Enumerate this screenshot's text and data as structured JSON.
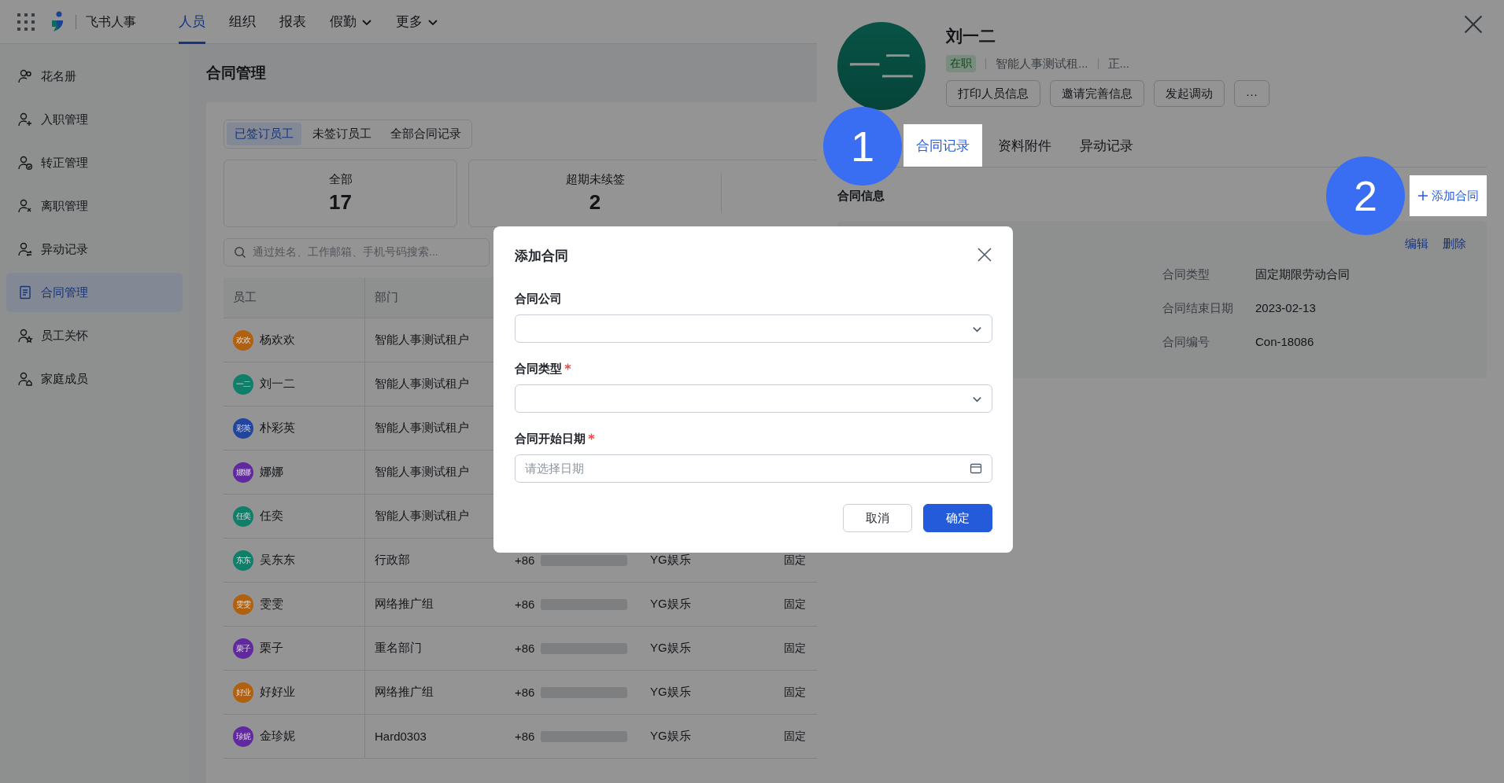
{
  "top_nav": {
    "app_name": "飞书人事",
    "tabs": [
      {
        "label": "人员",
        "selected": true,
        "has_caret": false
      },
      {
        "label": "组织",
        "selected": false,
        "has_caret": false
      },
      {
        "label": "报表",
        "selected": false,
        "has_caret": false
      },
      {
        "label": "假勤",
        "selected": false,
        "has_caret": true
      },
      {
        "label": "更多",
        "selected": false,
        "has_caret": true
      }
    ]
  },
  "sidebar": {
    "items": [
      {
        "label": "花名册",
        "selected": false
      },
      {
        "label": "入职管理",
        "selected": false
      },
      {
        "label": "转正管理",
        "selected": false
      },
      {
        "label": "离职管理",
        "selected": false
      },
      {
        "label": "异动记录",
        "selected": false
      },
      {
        "label": "合同管理",
        "selected": true
      },
      {
        "label": "员工关怀",
        "selected": false
      },
      {
        "label": "家庭成员",
        "selected": false
      }
    ]
  },
  "page": {
    "title": "合同管理",
    "filter_tabs": [
      {
        "label": "已签订员工",
        "selected": true
      },
      {
        "label": "未签订员工",
        "selected": false
      },
      {
        "label": "全部合同记录",
        "selected": false
      }
    ],
    "stats": [
      {
        "label": "全部",
        "value": "17"
      },
      {
        "label": "超期未续签",
        "value": "2"
      }
    ],
    "search": {
      "placeholder": "通过姓名、工作邮箱、手机号码搜索..."
    },
    "table": {
      "columns": [
        "员工",
        "部门"
      ],
      "rows": [
        {
          "avatar_text": "欢欢",
          "color": "#b0600e",
          "name": "杨欢欢",
          "department": "智能人事测试租户"
        },
        {
          "avatar_text": "一二",
          "color": "#0f7f6a",
          "name": "刘一二",
          "department": "智能人事测试租户"
        },
        {
          "avatar_text": "彩英",
          "color": "#21459f",
          "name": "朴彩英",
          "department": "智能人事测试租户"
        },
        {
          "avatar_text": "娜娜",
          "color": "#62289f",
          "name": "娜娜",
          "department": "智能人事测试租户"
        },
        {
          "avatar_text": "任奕",
          "color": "#0f7f6a",
          "name": "任奕",
          "department": "智能人事测试租户"
        },
        {
          "avatar_text": "东东",
          "color": "#0f7f6a",
          "name": "吴东东",
          "department": "行政部",
          "phone_prefix": "+86",
          "company": "YG娱乐",
          "column_5": "固定"
        },
        {
          "avatar_text": "雯雯",
          "color": "#b0600e",
          "name": "雯雯",
          "department": "网络推广组",
          "phone_prefix": "+86",
          "company": "YG娱乐",
          "column_5": "固定"
        },
        {
          "avatar_text": "栗子",
          "color": "#62289f",
          "name": "栗子",
          "department": "重名部门",
          "phone_prefix": "+86",
          "company": "YG娱乐",
          "column_5": "固定"
        },
        {
          "avatar_text": "好业",
          "color": "#b0600e",
          "name": "好好业",
          "department": "网络推广组",
          "phone_prefix": "+86",
          "company": "YG娱乐",
          "column_5": "固定"
        },
        {
          "avatar_text": "珍妮",
          "color": "#62289f",
          "name": "金珍妮",
          "department": "Hard0303",
          "phone_prefix": "+86",
          "company": "YG娱乐",
          "column_5": "固定"
        }
      ]
    }
  },
  "drawer": {
    "name": "刘一二",
    "avatar_text": "一二",
    "status": "在职",
    "meta": [
      "智能人事测试租...",
      "正..."
    ],
    "actions": [
      "打印人员信息",
      "邀请完善信息",
      "发起调动",
      "···"
    ],
    "tabs": [
      {
        "label": "合同记录",
        "selected": true,
        "highlighted": true,
        "callout": "1"
      },
      {
        "label": "资料附件",
        "selected": false,
        "highlighted": false
      },
      {
        "label": "异动记录",
        "selected": false,
        "highlighted": false
      }
    ],
    "section_title": "合同信息",
    "add_button": {
      "label": "添加合同",
      "highlighted": true,
      "callout": "2"
    },
    "record": {
      "actions": [
        "编辑",
        "删除"
      ],
      "fields": [
        {
          "label": "合同类型",
          "value": "固定期限劳动合同"
        },
        {
          "label": "合同结束日期",
          "value": "2023-02-13"
        },
        {
          "label": "合同编号",
          "value": "Con-18086"
        }
      ]
    }
  },
  "modal": {
    "title": "添加合同",
    "fields": [
      {
        "label": "合同公司",
        "required": false,
        "kind": "select"
      },
      {
        "label": "合同类型",
        "required": true,
        "kind": "select"
      },
      {
        "label": "合同开始日期",
        "required": true,
        "kind": "date",
        "placeholder": "请选择日期"
      }
    ],
    "buttons": [
      {
        "label": "取消",
        "kind": "secondary"
      },
      {
        "label": "确定",
        "kind": "primary"
      }
    ]
  }
}
